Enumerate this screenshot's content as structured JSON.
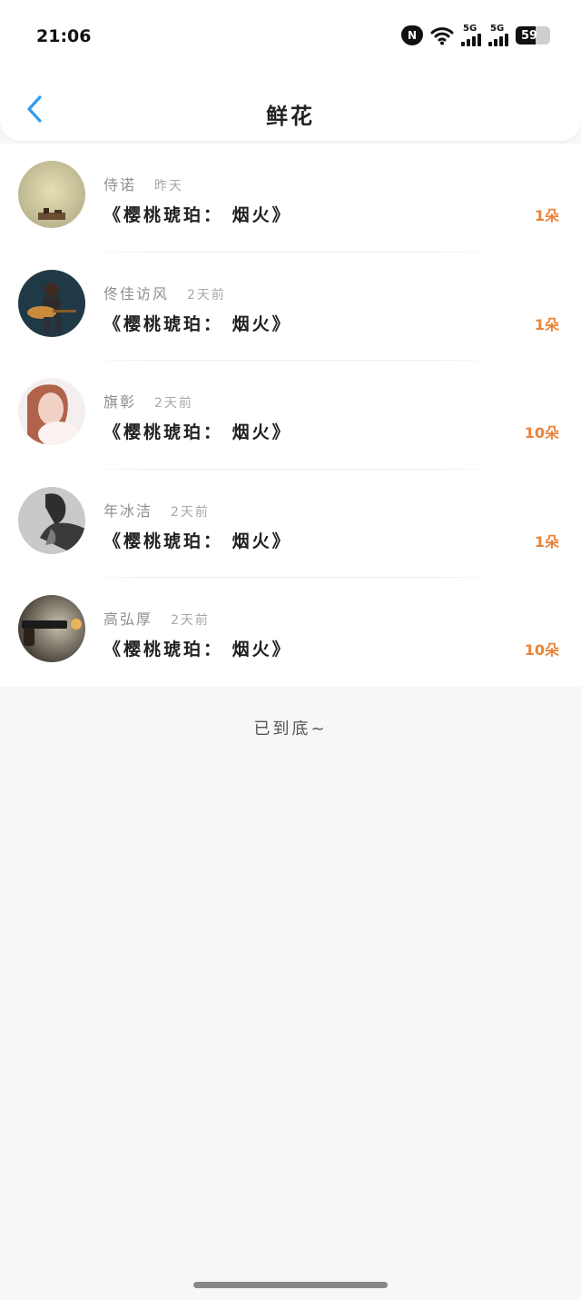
{
  "status_bar": {
    "time": "21:06",
    "notification_badge": "N",
    "sim1_label": "5G",
    "sim2_label": "5G",
    "battery_level": "59",
    "icons": [
      "notification-heart-icon",
      "wifi-icon",
      "signal-icon",
      "signal-icon",
      "battery-icon"
    ]
  },
  "nav": {
    "title": "鲜花",
    "back_icon": "chevron-left-icon"
  },
  "items": [
    {
      "name": "侍诺",
      "time": "昨天",
      "title": "《樱桃琥珀：  烟火》",
      "count": "1朵"
    },
    {
      "name": "佟佳访风",
      "time": "2天前",
      "title": "《樱桃琥珀：  烟火》",
      "count": "1朵"
    },
    {
      "name": "旗彰",
      "time": "2天前",
      "title": "《樱桃琥珀：  烟火》",
      "count": "10朵"
    },
    {
      "name": "年冰洁",
      "time": "2天前",
      "title": "《樱桃琥珀：  烟火》",
      "count": "1朵"
    },
    {
      "name": "高弘厚",
      "time": "2天前",
      "title": "《樱桃琥珀：  烟火》",
      "count": "10朵"
    }
  ],
  "footer": {
    "end_text": "已到底~"
  },
  "colors": {
    "accent": "#2f9cf0",
    "count": "#e9843a",
    "background": "#f8f6f7"
  }
}
